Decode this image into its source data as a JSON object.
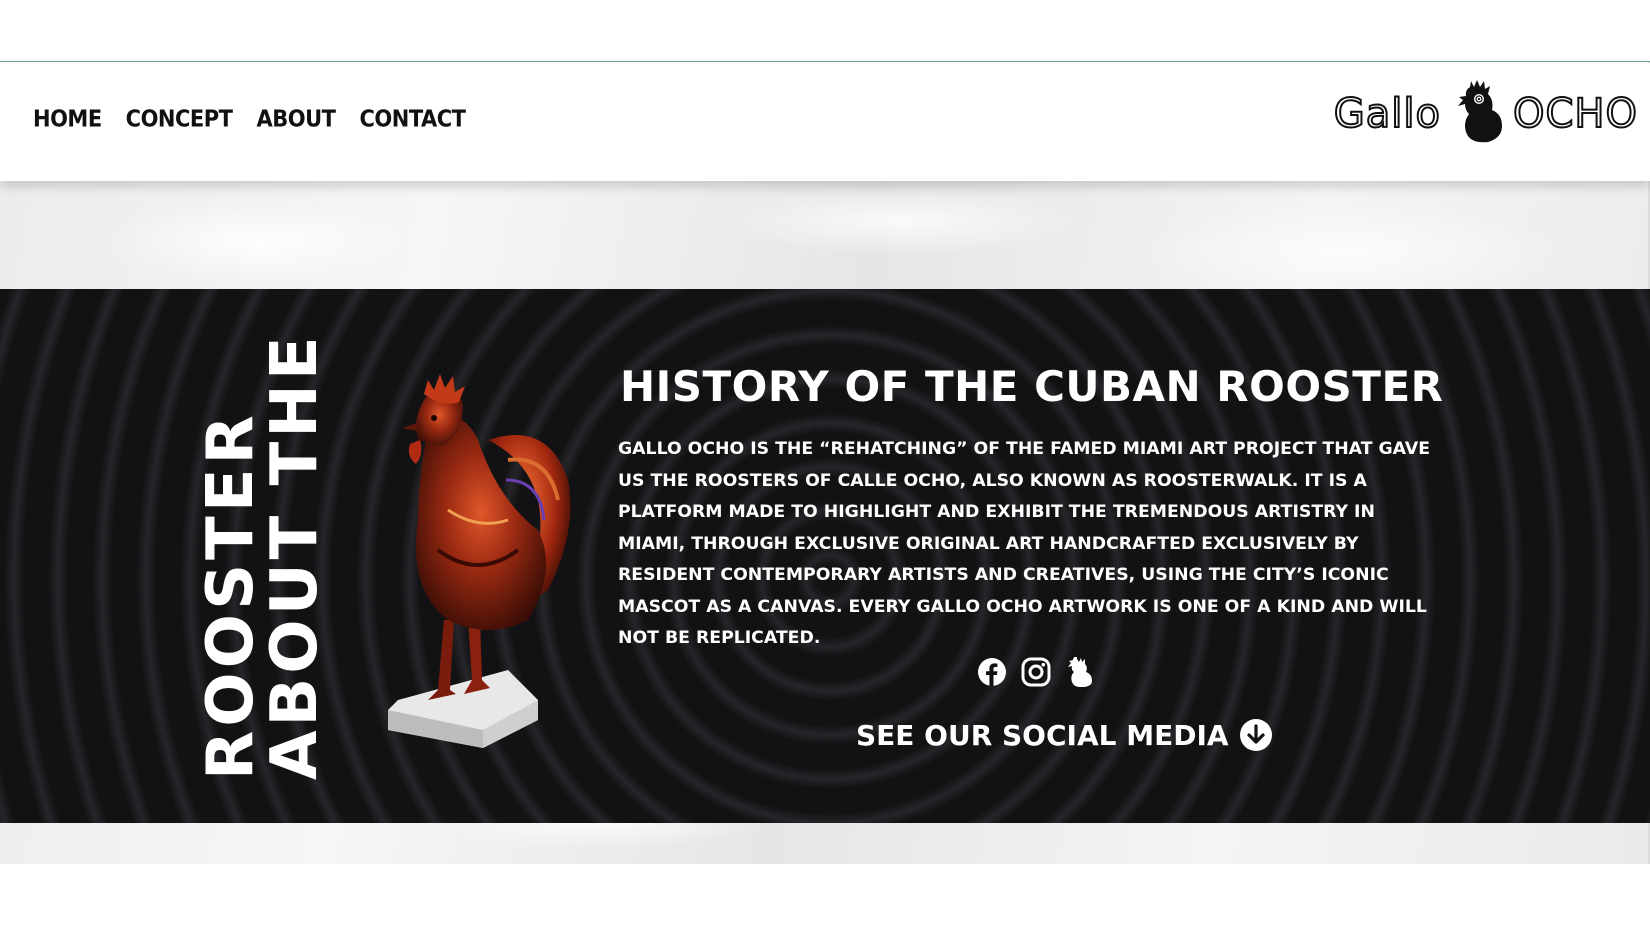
{
  "nav": {
    "links": [
      "HOME",
      "CONCEPT",
      "ABOUT",
      "CONTACT"
    ]
  },
  "logo": {
    "left_word": "Gallo",
    "right_word": "OCHO",
    "icon": "rooster-logo-icon"
  },
  "about": {
    "vertical_title_line1": "ABOUT THE",
    "vertical_title_line2": "ROOSTER",
    "headline": "HISTORY OF THE CUBAN ROOSTER",
    "body": "GALLO OCHO IS THE “REHATCHING” OF THE FAMED MIAMI ART PROJECT THAT GAVE US THE ROOSTERS OF CALLE OCHO, ALSO KNOWN AS ROOSTERWALK. IT IS A PLATFORM MADE TO HIGHLIGHT AND EXHIBIT THE TREMENDOUS ARTISTRY IN MIAMI, THROUGH EXCLUSIVE ORIGINAL ART HANDCRAFTED EXCLUSIVELY BY RESIDENT CONTEMPORARY ARTISTS AND CREATIVES, USING THE CITY’S ICONIC MASCOT AS A CANVAS. EVERY GALLO OCHO ARTWORK IS ONE OF A KIND AND WILL NOT BE REPLICATED.",
    "social_icons": [
      "facebook-icon",
      "instagram-icon",
      "rooster-icon"
    ],
    "cta_label": "SEE OUR SOCIAL MEDIA",
    "cta_icon": "arrow-down-circle-icon"
  },
  "colors": {
    "dark_band": "#121214",
    "text_light": "#ffffff",
    "nav_text": "#111111",
    "top_line": "#6fa79a"
  }
}
